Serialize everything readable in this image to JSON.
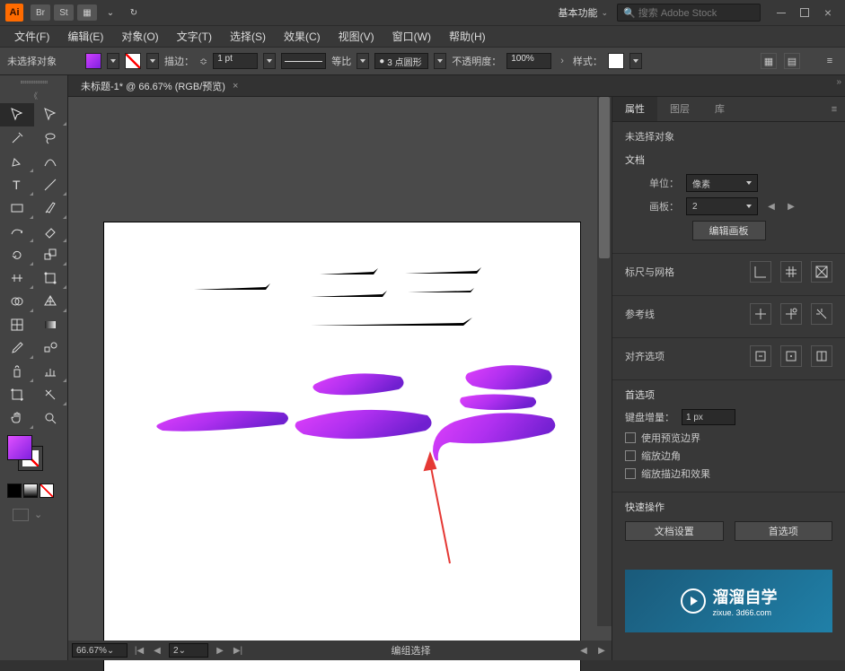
{
  "titlebar": {
    "logo": "Ai",
    "icons": [
      "Br",
      "St"
    ],
    "workspace": "基本功能",
    "search_placeholder": "搜索 Adobe Stock"
  },
  "menu": {
    "file": "文件(F)",
    "edit": "编辑(E)",
    "object": "对象(O)",
    "type": "文字(T)",
    "select": "选择(S)",
    "effect": "效果(C)",
    "view": "视图(V)",
    "window": "窗口(W)",
    "help": "帮助(H)"
  },
  "control": {
    "selection": "未选择对象",
    "stroke_label": "描边：",
    "stroke_val": "1 pt",
    "uniform": "等比",
    "dot_profile": "3 点圆形",
    "opacity_label": "不透明度：",
    "opacity_val": "100%",
    "style_label": "样式："
  },
  "tab": {
    "title": "未标题-1* @ 66.67% (RGB/预览)"
  },
  "status": {
    "zoom": "66.67%",
    "artboard": "2",
    "mode": "编组选择"
  },
  "props": {
    "tab_props": "属性",
    "tab_layers": "图层",
    "tab_libs": "库",
    "no_sel": "未选择对象",
    "doc": "文档",
    "unit_label": "单位：",
    "unit_val": "像素",
    "artboard_label": "画板：",
    "artboard_val": "2",
    "edit_artboard": "编辑画板",
    "rulers": "标尺与网格",
    "guides": "参考线",
    "align": "对齐选项",
    "prefs": "首选项",
    "kb_inc": "键盘增量：",
    "kb_val": "1 px",
    "cb1": "使用预览边界",
    "cb2": "缩放边角",
    "cb3": "缩放描边和效果",
    "quick": "快速操作",
    "doc_setup": "文档设置",
    "pref_btn": "首选项"
  },
  "logo": {
    "brand": "溜溜自学",
    "url": "zixue. 3d66.com"
  }
}
